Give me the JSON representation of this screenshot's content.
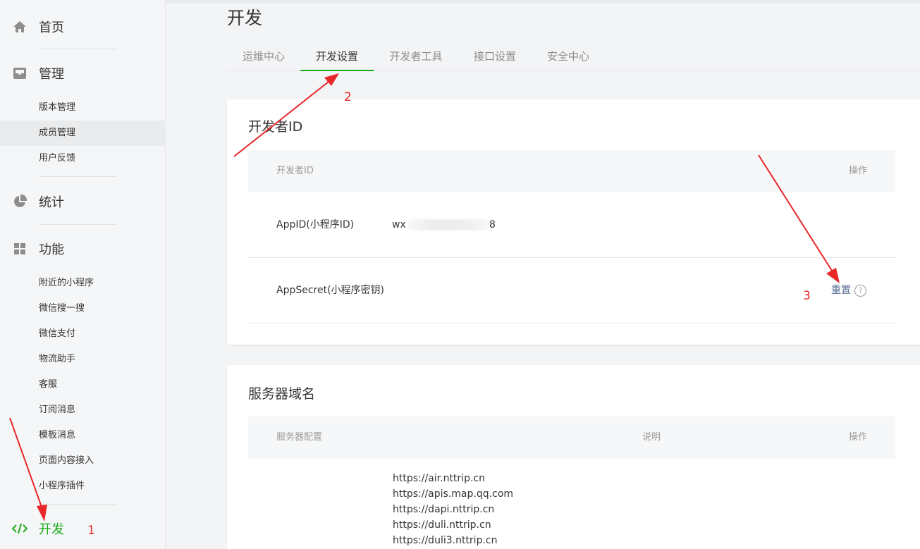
{
  "sidebar": {
    "home": "首页",
    "manage": "管理",
    "manage_items": [
      "版本管理",
      "成员管理",
      "用户反馈"
    ],
    "stats": "统计",
    "features": "功能",
    "feature_items": [
      "附近的小程序",
      "微信搜一搜",
      "微信支付",
      "物流助手",
      "客服",
      "订阅消息",
      "模板消息",
      "页面内容接入",
      "小程序插件"
    ],
    "develop": "开发",
    "accent": "#1aad19"
  },
  "main": {
    "title": "开发",
    "tabs": [
      "运维中心",
      "开发设置",
      "开发者工具",
      "接口设置",
      "安全中心"
    ],
    "active_tab": "开发设置"
  },
  "dev_id": {
    "title": "开发者ID",
    "col_id": "开发者ID",
    "col_action": "操作",
    "appid_label": "AppID(小程序ID)",
    "appid_prefix": "wx",
    "appid_suffix": "8",
    "secret_label": "AppSecret(小程序密钥)",
    "reset": "重置",
    "help": "?"
  },
  "server": {
    "title": "服务器域名",
    "col_config": "服务器配置",
    "col_desc": "说明",
    "col_action": "操作",
    "domains": [
      "https://air.nttrip.cn",
      "https://apis.map.qq.com",
      "https://dapi.nttrip.cn",
      "https://duli.nttrip.cn",
      "https://duli3.nttrip.cn"
    ]
  },
  "annotations": {
    "step1": "1",
    "step2": "2",
    "step3": "3",
    "color": "#e8272a"
  }
}
